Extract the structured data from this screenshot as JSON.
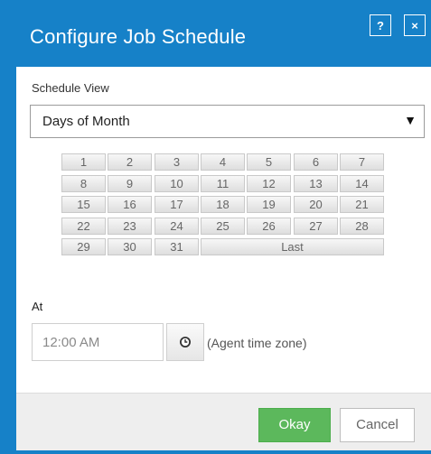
{
  "dialog": {
    "title": "Configure Job Schedule",
    "help_label": "?",
    "close_label": "×",
    "accent_color": "#1681c8"
  },
  "schedule_view": {
    "label": "Schedule View",
    "selected": "Days of Month",
    "arrow": "▼"
  },
  "days": {
    "items": [
      "1",
      "2",
      "3",
      "4",
      "5",
      "6",
      "7",
      "8",
      "9",
      "10",
      "11",
      "12",
      "13",
      "14",
      "15",
      "16",
      "17",
      "18",
      "19",
      "20",
      "21",
      "22",
      "23",
      "24",
      "25",
      "26",
      "27",
      "28",
      "29",
      "30",
      "31"
    ],
    "last_label": "Last"
  },
  "at": {
    "label": "At",
    "time_value": "12:00 AM",
    "clock_icon": "clock-icon",
    "timezone_note": "(Agent time zone)"
  },
  "footer": {
    "okay_label": "Okay",
    "cancel_label": "Cancel",
    "okay_color": "#5cb85c"
  }
}
